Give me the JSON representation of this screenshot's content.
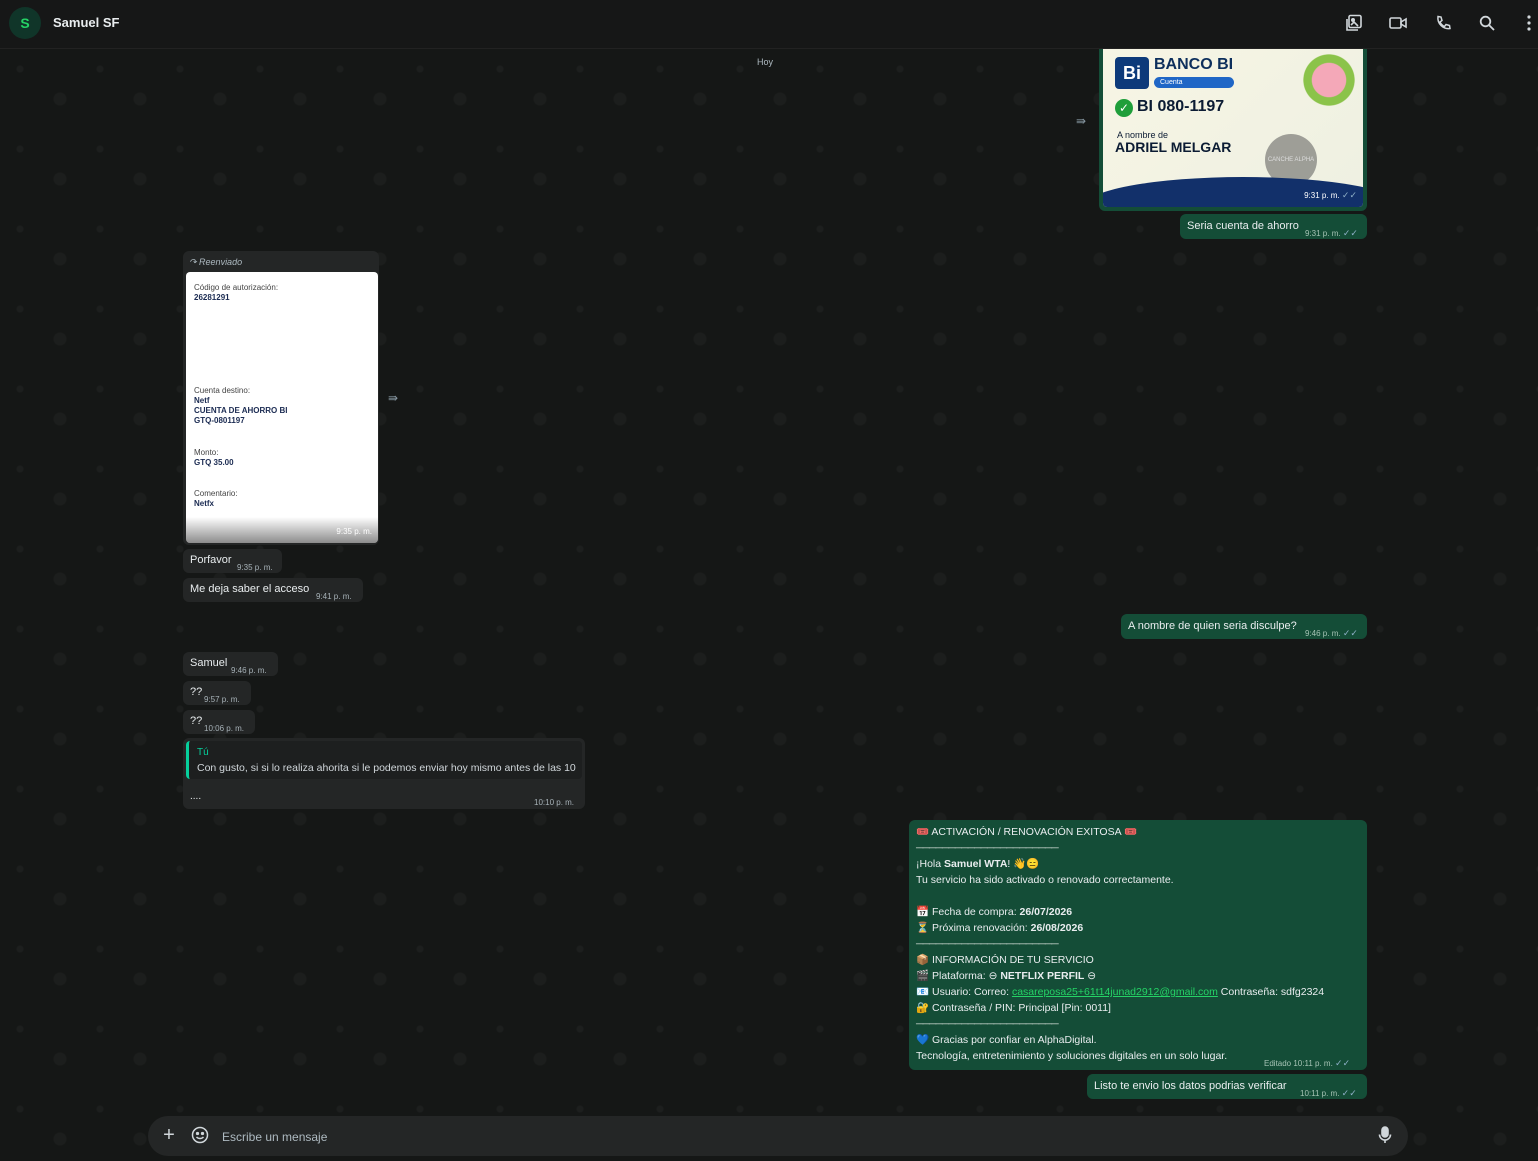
{
  "header": {
    "avatar_initial": "S",
    "contact_name": "Samuel SF"
  },
  "icons": [
    "gallery-icon",
    "video-call-icon",
    "phone-icon",
    "search-icon",
    "menu-icon"
  ],
  "day_chip": "Hoy",
  "messages": {
    "bank_image": {
      "bank_name": "BANCO BI",
      "badge": "Cuenta",
      "account": "BI 080-1197",
      "name_label": "A nombre de",
      "holder": "ADRIEL MELGAR",
      "logo_text": "CANCHE ALPHA",
      "time": "9:31 p. m."
    },
    "m_ahorro": {
      "text": "Seria cuenta de ahorro",
      "time": "9:31 p. m."
    },
    "receipt": {
      "forwarded_label": "Reenviado",
      "auth_label": "Código de autorización:",
      "auth_code": "26281291",
      "dest_label": "Cuenta destino:",
      "dest_1": "Netf",
      "dest_2": "CUENTA DE AHORRO BI",
      "dest_3": "GTQ-0801197",
      "amount_label": "Monto:",
      "amount": "GTQ 35.00",
      "comment_label": "Comentario:",
      "comment": "Netfx",
      "time": "9:35 p. m."
    },
    "m_porfavor": {
      "text": "Porfavor",
      "time": "9:35 p. m."
    },
    "m_acceso": {
      "text": "Me deja saber el acceso",
      "time": "9:41 p. m."
    },
    "m_nombre": {
      "text": "A nombre de quien seria disculpe?",
      "time": "9:46 p. m."
    },
    "m_samuel": {
      "text": "Samuel",
      "time": "9:46 p. m."
    },
    "m_q1": {
      "text": "??",
      "time": "9:57 p. m."
    },
    "m_q2": {
      "text": "??",
      "time": "10:06 p. m."
    },
    "m_reply": {
      "quote_author": "Tú",
      "quote_text": "Con gusto, si si lo realiza ahorita si le podemos enviar hoy mismo antes de las 10",
      "text": "....",
      "time": "10:10 p. m."
    },
    "m_activation": {
      "title": "🎟️ ACTIVACIÓN / RENOVACIÓN EXITOSA 🎟️",
      "divider": "──────────────────────",
      "greeting_prefix": "¡Hola ",
      "greeting_name": "Samuel WTA",
      "greeting_suffix": "! 👋😑",
      "service_line": "Tu servicio ha sido activado o renovado correctamente.",
      "purchase_prefix": "📅 Fecha de compra: ",
      "purchase_date": "26/07/2026",
      "renewal_prefix": "⏳ Próxima renovación: ",
      "renewal_date": "26/08/2026",
      "info_title": "📦 INFORMACIÓN DE TU SERVICIO",
      "platform_prefix": "🎬 Plataforma: ⊖ ",
      "platform": "NETFLIX PERFIL",
      "platform_suffix": " ⊖",
      "user_prefix": "📧 Usuario: Correo: ",
      "email": "casareposa25+61t14junad2912@gmail.com",
      "password_inline": " Contraseña: sdfg2324",
      "pin_line": "🔐 Contraseña / PIN: Principal [Pin: 0011]",
      "thanks": "💙 Gracias por confiar en AlphaDigital.",
      "tagline": "Tecnología, entretenimiento y soluciones digitales en un solo lugar.",
      "time": "Editado 10:11 p. m."
    },
    "m_listo": {
      "text": "Listo te envio los datos podrias verificar",
      "time": "10:11 p. m."
    }
  },
  "composer": {
    "placeholder": "Escribe un mensaje"
  },
  "colors": {
    "incoming": "#242626",
    "outgoing": "#144d37",
    "accent": "#25d366"
  }
}
